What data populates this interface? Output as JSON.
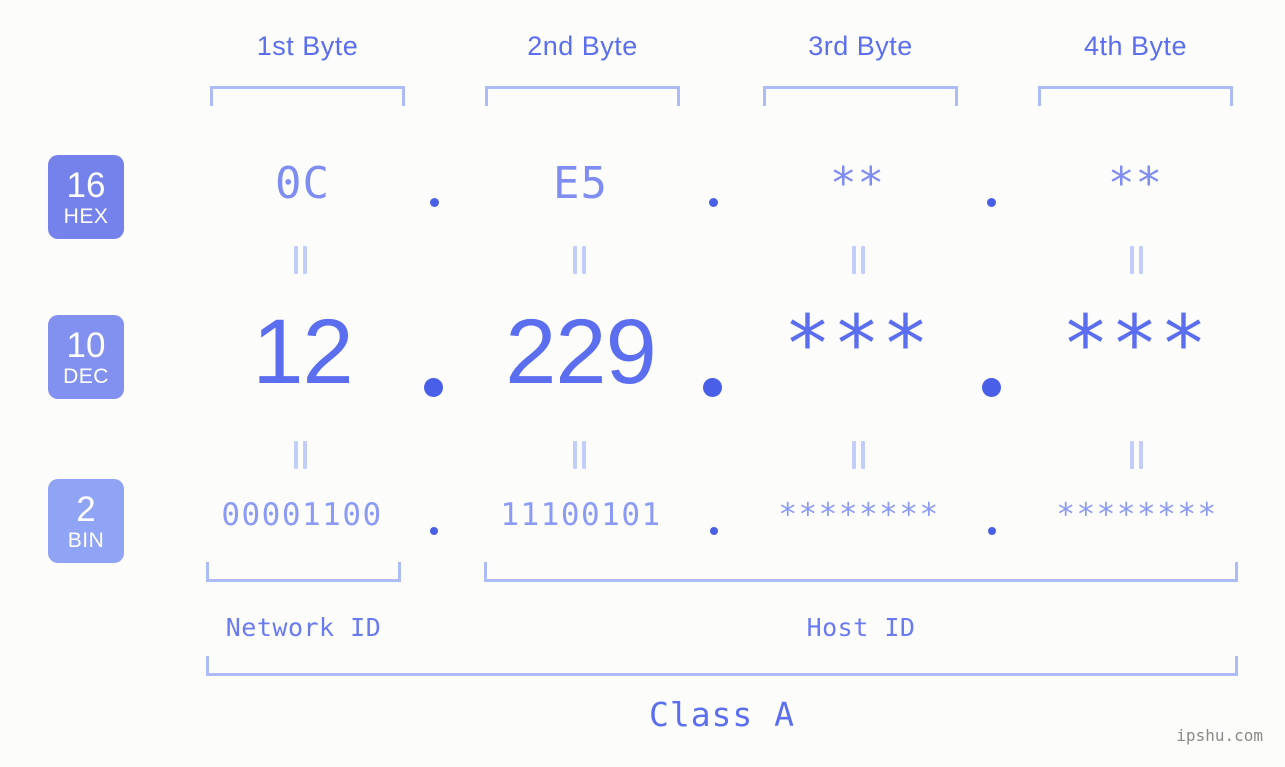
{
  "page": {
    "background_color": "#fcfdfa",
    "accent_color": "#5b6ef0",
    "accent_light_color": "#adbbf7",
    "watermark": "ipshu.com"
  },
  "byte_headers": [
    {
      "label": "1st Byte"
    },
    {
      "label": "2nd Byte"
    },
    {
      "label": "3rd Byte"
    },
    {
      "label": "4th Byte"
    }
  ],
  "bases": [
    {
      "number": "16",
      "name": "HEX",
      "color": "#7582ec"
    },
    {
      "number": "10",
      "name": "DEC",
      "color": "#8290f0"
    },
    {
      "number": "2",
      "name": "BIN",
      "color": "#8fa4f5"
    }
  ],
  "rows": {
    "hex": {
      "values": [
        "0C",
        "E5",
        "**",
        "**"
      ]
    },
    "dec": {
      "values": [
        "12",
        "229",
        "***",
        "***"
      ]
    },
    "bin": {
      "values": [
        "00001100",
        "11100101",
        "********",
        "********"
      ]
    }
  },
  "separators": {
    "dot": ".",
    "equals": "="
  },
  "sections": [
    {
      "label": "Network ID"
    },
    {
      "label": "Host ID"
    }
  ],
  "class": {
    "label": "Class A"
  }
}
